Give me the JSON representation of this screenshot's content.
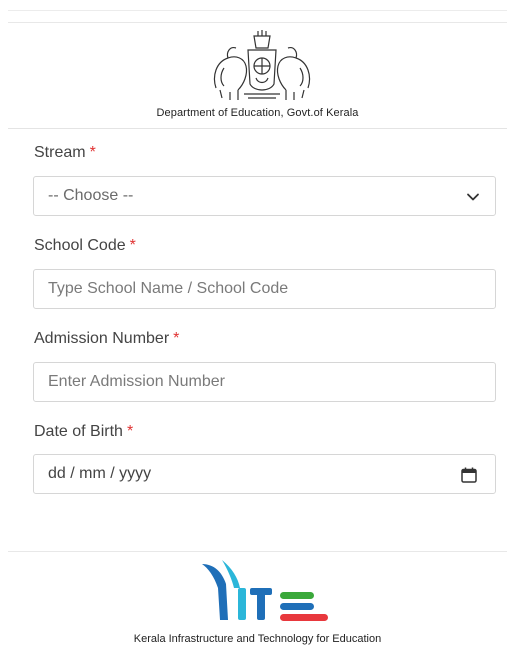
{
  "header": {
    "department": "Department of Education, Govt.of Kerala",
    "emblem_icon": "kerala-emblem-icon"
  },
  "form": {
    "stream": {
      "label": "Stream",
      "required_mark": "*",
      "selected": "-- Choose --",
      "icon": "chevron-down-icon"
    },
    "school_code": {
      "label": "School Code",
      "required_mark": "*",
      "placeholder": "Type School Name / School Code"
    },
    "admission_number": {
      "label": "Admission Number",
      "required_mark": "*",
      "placeholder": "Enter Admission Number"
    },
    "date_of_birth": {
      "label": "Date of Birth",
      "required_mark": "*",
      "placeholder": "dd / mm / yyyy",
      "icon": "calendar-icon"
    }
  },
  "footer": {
    "organization": "Kerala Infrastructure and Technology for Education",
    "logo_icon": "kite-logo-icon",
    "colors": {
      "blue": "#1f6fb8",
      "cyan": "#2bb6d9",
      "green": "#3aa83a",
      "red": "#e8383d"
    }
  },
  "colors": {
    "required": "#e03131",
    "border": "#d6d6d6"
  }
}
